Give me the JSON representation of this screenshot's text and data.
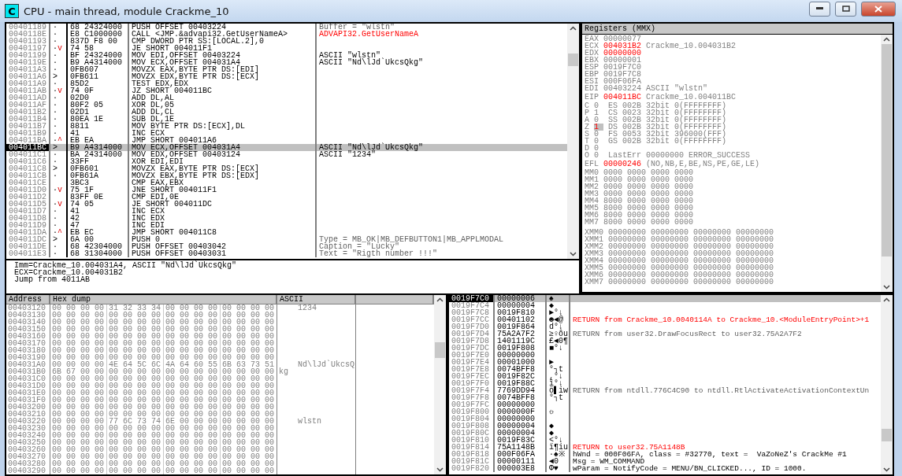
{
  "window": {
    "icon_letter": "C",
    "title": "CPU - main thread, module Crackme_10"
  },
  "disassembly": {
    "rows": [
      {
        "address": "00401189",
        "mark": "·",
        "bytes": "68 24324000",
        "command": "PUSH OFFSET 00403224",
        "comment": "Buffer = \"wlstn\"",
        "highlighted": false,
        "muted": true,
        "selected": false
      },
      {
        "address": "0040118E",
        "mark": "·",
        "bytes": "E8 C1000000",
        "command": "CALL <JMP.&advapi32.GetUserNameA>",
        "comment": "ADVAPI32.GetUserNameA",
        "highlighted": true,
        "muted": false,
        "selected": false
      },
      {
        "address": "00401193",
        "mark": "·",
        "bytes": "837D F8 00",
        "command": "CMP DWORD PTR SS:[LOCAL.2],0",
        "selected": false
      },
      {
        "address": "00401197",
        "mark": "·",
        "arrow": "v",
        "bytes": "74 58",
        "command": "JE SHORT 004011F1",
        "selected": false
      },
      {
        "address": "00401199",
        "mark": "·",
        "bytes": "BF 24324000",
        "command": "MOV EDI,OFFSET 00403224",
        "comment": "ASCII \"wlstn\"",
        "highlighted": false,
        "muted": false,
        "selected": false
      },
      {
        "address": "0040119E",
        "mark": "·",
        "bytes": "B9 A4314000",
        "command": "MOV ECX,OFFSET 004031A4",
        "comment": "ASCII \"Nd\\lJd`UkcsQkg\"",
        "highlighted": false,
        "muted": false,
        "selected": false
      },
      {
        "address": "004011A3",
        "mark": "·",
        "bytes": "0FB607",
        "command": "MOVZX EAX,BYTE PTR DS:[EDI]",
        "selected": false
      },
      {
        "address": "004011A6",
        "mark": ">",
        "bytes": "0FB611",
        "command": "MOVZX EDX,BYTE PTR DS:[ECX]",
        "selected": false
      },
      {
        "address": "004011A9",
        "mark": "·",
        "bytes": "85D2",
        "command": "TEST EDX,EDX",
        "selected": false
      },
      {
        "address": "004011AB",
        "mark": "·",
        "arrow": "v",
        "bytes": "74 0F",
        "command": "JZ SHORT 004011BC",
        "selected": false
      },
      {
        "address": "004011AD",
        "mark": "·",
        "bytes": "02D0",
        "command": "ADD DL,AL",
        "selected": false
      },
      {
        "address": "004011AF",
        "mark": "·",
        "bytes": "80F2 05",
        "command": "XOR DL,05",
        "selected": false
      },
      {
        "address": "004011B2",
        "mark": "·",
        "bytes": "02D1",
        "command": "ADD DL,CL",
        "selected": false
      },
      {
        "address": "004011B4",
        "mark": "·",
        "bytes": "80EA 1E",
        "command": "SUB DL,1E",
        "selected": false
      },
      {
        "address": "004011B7",
        "mark": "·",
        "bytes": "8811",
        "command": "MOV BYTE PTR DS:[ECX],DL",
        "selected": false
      },
      {
        "address": "004011B9",
        "mark": "·",
        "bytes": "41",
        "command": "INC ECX",
        "selected": false
      },
      {
        "address": "004011BA",
        "mark": "·",
        "arrow": "^",
        "bytes": "EB EA",
        "command": "JMP SHORT 004011A6",
        "selected": false
      },
      {
        "address": "004011BC",
        "mark": ">",
        "bytes": "B9 A4314000",
        "command": "MOV ECX,OFFSET 004031A4",
        "comment": "ASCII \"Nd\\lJd`UkcsQkg\"",
        "highlighted": false,
        "muted": false,
        "selected": true
      },
      {
        "address": "004011C1",
        "mark": "·",
        "bytes": "BA 24314000",
        "command": "MOV EDX,OFFSET 00403124",
        "comment": "ASCII \"1234\"",
        "highlighted": false,
        "muted": false,
        "selected": false
      },
      {
        "address": "004011C6",
        "mark": "·",
        "bytes": "33FF",
        "command": "XOR EDI,EDI",
        "selected": false
      },
      {
        "address": "004011C8",
        "mark": ">",
        "bytes": "0FB601",
        "command": "MOVZX EAX,BYTE PTR DS:[ECX]",
        "selected": false
      },
      {
        "address": "004011CB",
        "mark": "·",
        "bytes": "0FB61A",
        "command": "MOVZX EBX,BYTE PTR DS:[EDX]",
        "selected": false
      },
      {
        "address": "004011CE",
        "bytes": "3BC3",
        "command": "CMP EAX,EBX",
        "selected": false
      },
      {
        "address": "004011D0",
        "mark": "·",
        "arrow": "v",
        "bytes": "75 1F",
        "command": "JNE SHORT 004011F1",
        "selected": false
      },
      {
        "address": "004011D2",
        "bytes": "83FF 0E",
        "command": "CMP EDI,0E",
        "selected": false
      },
      {
        "address": "004011D5",
        "mark": "·",
        "arrow": "v",
        "bytes": "74 05",
        "command": "JE SHORT 004011DC",
        "selected": false
      },
      {
        "address": "004011D7",
        "mark": "·",
        "bytes": "41",
        "command": "INC ECX",
        "selected": false
      },
      {
        "address": "004011D8",
        "mark": "·",
        "bytes": "42",
        "command": "INC EDX",
        "selected": false
      },
      {
        "address": "004011D9",
        "mark": "·",
        "bytes": "47",
        "command": "INC EDI",
        "selected": false
      },
      {
        "address": "004011DA",
        "mark": "·",
        "arrow": "^",
        "bytes": "EB EC",
        "command": "JMP SHORT 004011C8",
        "selected": false
      },
      {
        "address": "004011DC",
        "mark": ">",
        "bytes": "6A 00",
        "command": "PUSH 0",
        "comment": "Type = MB_OK|MB_DEFBUTTON1|MB_APPLMODAL",
        "highlighted": false,
        "muted": true,
        "selected": false
      },
      {
        "address": "004011DE",
        "mark": "·",
        "bytes": "68 42304000",
        "command": "PUSH OFFSET 00403042",
        "comment": "Caption = \"Lucky\"",
        "highlighted": false,
        "muted": true,
        "selected": false
      },
      {
        "address": "004011E3",
        "mark": "·",
        "bytes": "68 31304000",
        "command": "PUSH OFFSET 00403031",
        "comment": "Text = \"Rigth number !!!\"",
        "highlighted": false,
        "muted": true,
        "selected": false
      }
    ]
  },
  "info": [
    "Imm=Crackme_10.004031A4, ASCII \"Nd\\lJd`UkcsQkg\"",
    "ECX=Crackme_10.004031B2",
    "Jump from 4011AB"
  ],
  "registers": {
    "title": "Registers (MMX)",
    "general": [
      {
        "name": "EAX",
        "value": "00000077",
        "changed": false
      },
      {
        "name": "ECX",
        "value": "004031B2",
        "changed": true,
        "comment": "Crackme_10.004031B2"
      },
      {
        "name": "EDX",
        "value": "00000000",
        "changed": true
      },
      {
        "name": "EBX",
        "value": "00000001",
        "changed": false
      },
      {
        "name": "ESP",
        "value": "0019F7C0",
        "changed": false
      },
      {
        "name": "EBP",
        "value": "0019F7C8",
        "changed": false
      },
      {
        "name": "ESI",
        "value": "000F06FA",
        "changed": false
      },
      {
        "name": "EDI",
        "value": "00403224",
        "changed": false,
        "comment": "ASCII \"wlstn\""
      }
    ],
    "eip": {
      "name": "EIP",
      "value": "004011BC",
      "changed": true,
      "comment": "Crackme_10.004011BC"
    },
    "flags": [
      {
        "name": "C",
        "value": "0",
        "changed": false,
        "detail": "ES 002B 32bit 0(FFFFFFFF)"
      },
      {
        "name": "P",
        "value": "1",
        "changed": false,
        "detail": "CS 0023 32bit 0(FFFFFFFF)"
      },
      {
        "name": "A",
        "value": "0",
        "changed": false,
        "detail": "SS 002B 32bit 0(FFFFFFFF)"
      },
      {
        "name": "Z",
        "value": "1",
        "changed": true,
        "detail": "DS 002B 32bit 0(FFFFFFFF)"
      },
      {
        "name": "S",
        "value": "0",
        "changed": false,
        "detail": "FS 0053 32bit 396000(FFF)"
      },
      {
        "name": "T",
        "value": "0",
        "changed": false,
        "detail": "GS 002B 32bit 0(FFFFFFFF)"
      },
      {
        "name": "D",
        "value": "0",
        "changed": false
      },
      {
        "name": "O",
        "value": "0",
        "changed": false,
        "detail": "LastErr 00000000 ERROR_SUCCESS"
      }
    ],
    "efl": {
      "name": "EFL",
      "value": "00000246",
      "changed": true,
      "comment": "(NO,NB,E,BE,NS,PE,GE,LE)"
    },
    "mmx": [
      {
        "name": "MM0",
        "value": "0000 0000 0000 0000"
      },
      {
        "name": "MM1",
        "value": "0000 0000 0000 0000"
      },
      {
        "name": "MM2",
        "value": "0000 0000 0000 0000"
      },
      {
        "name": "MM3",
        "value": "0000 0000 0000 0000"
      },
      {
        "name": "MM4",
        "value": "8000 0000 0000 0000"
      },
      {
        "name": "MM5",
        "value": "8000 0000 0000 0000"
      },
      {
        "name": "MM6",
        "value": "8000 0000 0000 0000"
      },
      {
        "name": "MM7",
        "value": "8000 0000 0000 0000"
      }
    ],
    "xmm": [
      {
        "name": "XMM0",
        "value": "00000000 00000000 00000000 00000000"
      },
      {
        "name": "XMM1",
        "value": "00000000 00000000 00000000 00000000"
      },
      {
        "name": "XMM2",
        "value": "00000000 00000000 00000000 00000000"
      },
      {
        "name": "XMM3",
        "value": "00000000 00000000 00000000 00000000"
      },
      {
        "name": "XMM4",
        "value": "00000000 00000000 00000000 00000000"
      },
      {
        "name": "XMM5",
        "value": "00000000 00000000 00000000 00000000"
      },
      {
        "name": "XMM6",
        "value": "00000000 00000000 00000000 00000000"
      },
      {
        "name": "XMM7",
        "value": "00000000 00000000 00000000 00000000"
      }
    ]
  },
  "dump": {
    "columns": [
      "Address",
      "Hex dump",
      "ASCII"
    ],
    "rows": [
      {
        "address": "00403120",
        "hex": [
          "00 00 00 00",
          "31 32 33 34",
          "00 00 00 00",
          "00 00 00 00"
        ],
        "ascii": "    1234"
      },
      {
        "address": "00403130",
        "hex": [
          "00 00 00 00",
          "00 00 00 00",
          "00 00 00 00",
          "00 00 00 00"
        ]
      },
      {
        "address": "00403140",
        "hex": [
          "00 00 00 00",
          "00 00 00 00",
          "00 00 00 00",
          "00 00 00 00"
        ]
      },
      {
        "address": "00403150",
        "hex": [
          "00 00 00 00",
          "00 00 00 00",
          "00 00 00 00",
          "00 00 00 00"
        ]
      },
      {
        "address": "00403160",
        "hex": [
          "00 00 00 00",
          "00 00 00 00",
          "00 00 00 00",
          "00 00 00 00"
        ]
      },
      {
        "address": "00403170",
        "hex": [
          "00 00 00 00",
          "00 00 00 00",
          "00 00 00 00",
          "00 00 00 00"
        ]
      },
      {
        "address": "00403180",
        "hex": [
          "00 00 00 00",
          "00 00 00 00",
          "00 00 00 00",
          "00 00 00 00"
        ]
      },
      {
        "address": "00403190",
        "hex": [
          "00 00 00 00",
          "00 00 00 00",
          "00 00 00 00",
          "00 00 00 00"
        ]
      },
      {
        "address": "004031A0",
        "hex": [
          "00 00 00 00",
          "4E 64 5C 6C",
          "4A 64 60 55",
          "6B 63 73 51"
        ],
        "ascii": "    Nd\\lJd`UkcsQ"
      },
      {
        "address": "004031B0",
        "hex": [
          "6B 67 00 00",
          "00 00 00 00",
          "00 00 00 00",
          "00 00 00 00"
        ],
        "ascii": "kg"
      },
      {
        "address": "004031C0",
        "hex": [
          "00 00 00 00",
          "00 00 00 00",
          "00 00 00 00",
          "00 00 00 00"
        ]
      },
      {
        "address": "004031D0",
        "hex": [
          "00 00 00 00",
          "00 00 00 00",
          "00 00 00 00",
          "00 00 00 00"
        ]
      },
      {
        "address": "004031E0",
        "hex": [
          "00 00 00 00",
          "00 00 00 00",
          "00 00 00 00",
          "00 00 00 00"
        ]
      },
      {
        "address": "004031F0",
        "hex": [
          "00 00 00 00",
          "00 00 00 00",
          "00 00 00 00",
          "00 00 00 00"
        ]
      },
      {
        "address": "00403200",
        "hex": [
          "00 00 00 00",
          "00 00 00 00",
          "00 00 00 00",
          "00 00 00 00"
        ]
      },
      {
        "address": "00403210",
        "hex": [
          "00 00 00 00",
          "00 00 00 00",
          "00 00 00 00",
          "00 00 00 00"
        ]
      },
      {
        "address": "00403220",
        "hex": [
          "00 00 00 00",
          "77 6C 73 74",
          "6E 00 00 00",
          "00 00 00 00"
        ],
        "ascii": "    wlstn"
      },
      {
        "address": "00403230",
        "hex": [
          "00 00 00 00",
          "00 00 00 00",
          "00 00 00 00",
          "00 00 00 00"
        ]
      },
      {
        "address": "00403240",
        "hex": [
          "00 00 00 00",
          "00 00 00 00",
          "00 00 00 00",
          "00 00 00 00"
        ]
      },
      {
        "address": "00403250",
        "hex": [
          "00 00 00 00",
          "00 00 00 00",
          "00 00 00 00",
          "00 00 00 00"
        ]
      },
      {
        "address": "00403260",
        "hex": [
          "00 00 00 00",
          "00 00 00 00",
          "00 00 00 00",
          "00 00 00 00"
        ]
      },
      {
        "address": "00403270",
        "hex": [
          "00 00 00 00",
          "00 00 00 00",
          "00 00 00 00",
          "00 00 00 00"
        ]
      },
      {
        "address": "00403280",
        "hex": [
          "00 00 00 00",
          "00 00 00 00",
          "00 00 00 00",
          "00 00 00 00"
        ]
      },
      {
        "address": "00403290",
        "hex": [
          "00 00 00 00",
          "00 00 00 00",
          "00 00 00 00",
          "00 00 00 00"
        ]
      }
    ]
  },
  "stack": {
    "rows": [
      {
        "address": "0019F7C0",
        "value": "00000006",
        "chars": "♠",
        "selected": true
      },
      {
        "address": "0019F7C4",
        "value": "00000004",
        "chars": "◆",
        "selected": false
      },
      {
        "address": "0019F7C8",
        "value": "0019F810",
        "chars": "►°↓",
        "selected": false
      },
      {
        "address": "0019F7CC",
        "value": "00401102",
        "chars": "☻◄@",
        "comment": "RETURN from Crackme_10.0040114A to Crackme_10.<ModuleEntryPoint>+1",
        "highlighted": true,
        "muted": false,
        "selected": false
      },
      {
        "address": "0019F7D0",
        "value": "0019F864",
        "chars": "d°↓",
        "selected": false
      },
      {
        "address": "0019F7D4",
        "value": "75A2A7F2",
        "chars": "≥♀ôu",
        "comment": "RETURN from user32.DrawFocusRect to user32.75A2A7F2",
        "highlighted": false,
        "muted": true,
        "selected": false
      },
      {
        "address": "0019F7D8",
        "value": "1401119C",
        "chars": "£◄0¶",
        "selected": false
      },
      {
        "address": "0019F7DC",
        "value": "0019F808",
        "chars": "■°↓",
        "selected": false
      },
      {
        "address": "0019F7E0",
        "value": "00000000",
        "selected": false
      },
      {
        "address": "0019F7E4",
        "value": "00001000",
        "chars": "►",
        "selected": false
      },
      {
        "address": "0019F7E8",
        "value": "0074BFF8",
        "chars": "°┐t",
        "selected": false
      },
      {
        "address": "0019F7EC",
        "value": "0019F82C",
        "chars": ",°↓",
        "selected": false
      },
      {
        "address": "0019F7F0",
        "value": "0019F88C",
        "chars": "î°↓",
        "selected": false
      },
      {
        "address": "0019F7F4",
        "value": "7769DD94",
        "chars": "ö▌iw",
        "comment": "RETURN from ntdll.776C4C90 to ntdll.RtlActivateActivationContextUn",
        "highlighted": false,
        "muted": true,
        "selected": false
      },
      {
        "address": "0019F7F8",
        "value": "0074BFF8",
        "chars": "°┐t",
        "selected": false
      },
      {
        "address": "0019F7FC",
        "value": "00000000",
        "selected": false
      },
      {
        "address": "0019F800",
        "value": "0000000F",
        "chars": "☼",
        "selected": false
      },
      {
        "address": "0019F804",
        "value": "00000000",
        "selected": false
      },
      {
        "address": "0019F808",
        "value": "00000004",
        "chars": "◆",
        "selected": false
      },
      {
        "address": "0019F80C",
        "value": "00000004",
        "chars": "◆",
        "selected": false
      },
      {
        "address": "0019F810",
        "value": "0019F83C",
        "chars": "<°↓",
        "selected": false
      },
      {
        "address": "0019F814",
        "value": "75A1148B",
        "chars": "ï¶iu",
        "comment": "RETURN to user32.75A1148B",
        "highlighted": true,
        "muted": false,
        "selected": false
      },
      {
        "address": "0019F818",
        "value": "000F06FA",
        "chars": "·♠※",
        "comment": "hWnd = 000F06FA, class = #32770, text =  VaZoNeZ's CrackMe #1",
        "highlighted": false,
        "muted": false,
        "selected": false
      },
      {
        "address": "0019F81C",
        "value": "00000111",
        "chars": "◄0",
        "comment": "Msg = WM_COMMAND",
        "highlighted": false,
        "muted": false,
        "selected": false
      },
      {
        "address": "0019F820",
        "value": "000003E8",
        "chars": "Φ♥",
        "comment": "wParam = NotifyCode = MENU/BN_CLICKED..., ID = 1000.",
        "highlighted": false,
        "muted": false,
        "selected": false
      }
    ]
  }
}
